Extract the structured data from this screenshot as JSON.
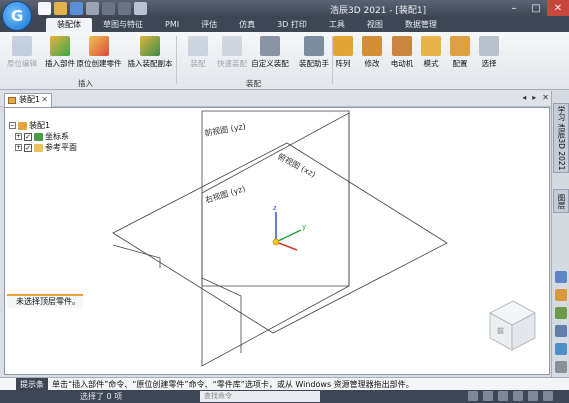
{
  "window": {
    "title": "浩辰3D 2021 - [装配1]"
  },
  "ribbon_tabs": [
    "装配体",
    "草图与特征",
    "PMI",
    "评估",
    "仿真",
    "3D 打印",
    "工具",
    "视图",
    "数据管理"
  ],
  "ribbon": {
    "insert": {
      "original_edit": "原位编辑",
      "insert_part": "插入部件",
      "create_part_in_place": "原位创建零件",
      "insert_copy": "插入装配副本",
      "group_label": "插入"
    },
    "assemble": {
      "assemble": "装配",
      "fast_assemble": "快速装配",
      "custom_assemble": "自定义装配",
      "assemble_helper": "装配助手",
      "group_label": "装配"
    },
    "others": {
      "array": "阵列",
      "modify": "修改",
      "motor": "电动机",
      "pattern": "模式",
      "config": "配置",
      "select": "选择"
    }
  },
  "document": {
    "tab_label": "装配1"
  },
  "tree": {
    "root": "装配1",
    "items": [
      "坐标系",
      "参考平面"
    ]
  },
  "viewport": {
    "plane_front": "前视图 (yz)",
    "plane_top": "俯视图 (xz)",
    "plane_right": "右视图 (yz)",
    "cube_label": "前"
  },
  "hint": "未选择顶层零件。",
  "sidebar": {
    "tab1": "学习 浩辰3D 2021",
    "tab2": "图层"
  },
  "command": {
    "label": "提示条",
    "text": "单击“插入部件”命令、“原位创建零件”命令、“零件库”选项卡，或从 Windows 资源管理器拖出部件。"
  },
  "status": {
    "selected": "选择了 0 项",
    "search_placeholder": "查找命令"
  }
}
